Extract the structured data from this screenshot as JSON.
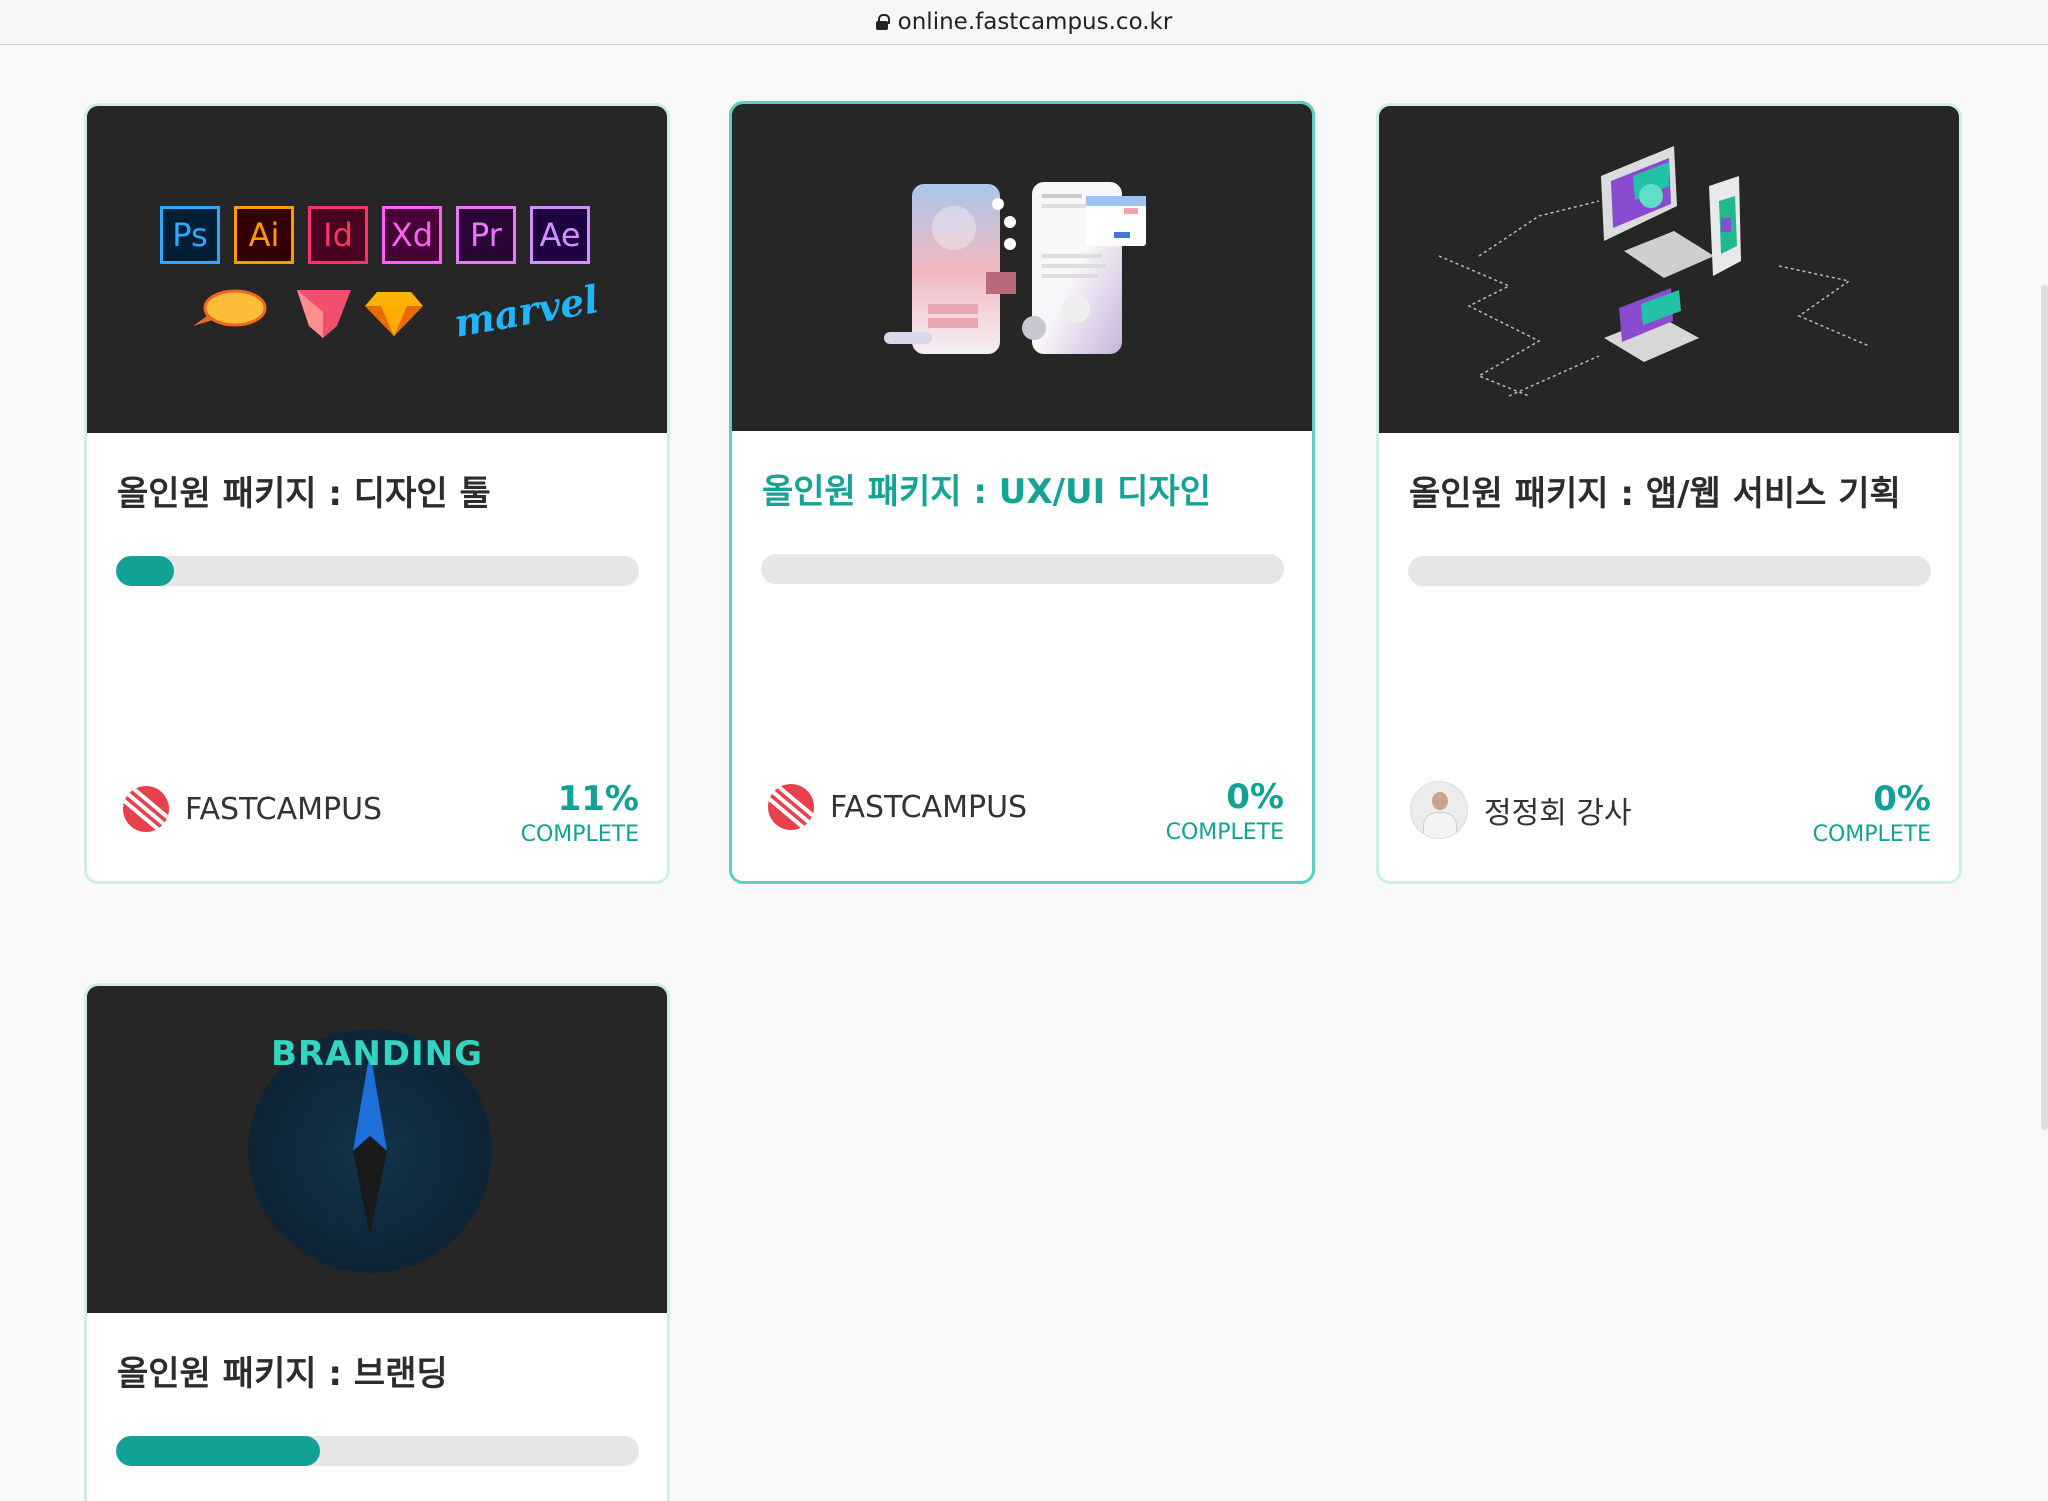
{
  "browser": {
    "url": "online.fastcampus.co.kr"
  },
  "courses": [
    {
      "title": "올인원 패키지 : 디자인 툴",
      "progress": 0.11,
      "owner": "FASTCAMPUS",
      "percent_label": "11%",
      "complete_label": "COMPLETE",
      "app_icons": [
        "Ps",
        "Ai",
        "Id",
        "Xd",
        "Pr",
        "Ae"
      ],
      "tool_logos": [
        "zeplin-icon",
        "framer-icon",
        "sketch-icon",
        "marvel-logo"
      ],
      "marvel_text": "marvel"
    },
    {
      "title": "올인원 패키지 : UX/UI 디자인",
      "progress": 0,
      "owner": "FASTCAMPUS",
      "percent_label": "0%",
      "complete_label": "COMPLETE"
    },
    {
      "title": "올인원 패키지 : 앱/웹 서비스 기획",
      "progress": 0,
      "owner": "정정회 강사",
      "percent_label": "0%",
      "complete_label": "COMPLETE"
    },
    {
      "title": "올인원 패키지 : 브랜딩",
      "progress": 0.39,
      "thumb_text": "BRANDING"
    }
  ],
  "colors": {
    "accent": "#11a195",
    "card_border": "#cdeeeb",
    "selected_border": "#5ccfc5",
    "thumb_bg": "#262626",
    "fastcampus_red": "#e8404c"
  }
}
